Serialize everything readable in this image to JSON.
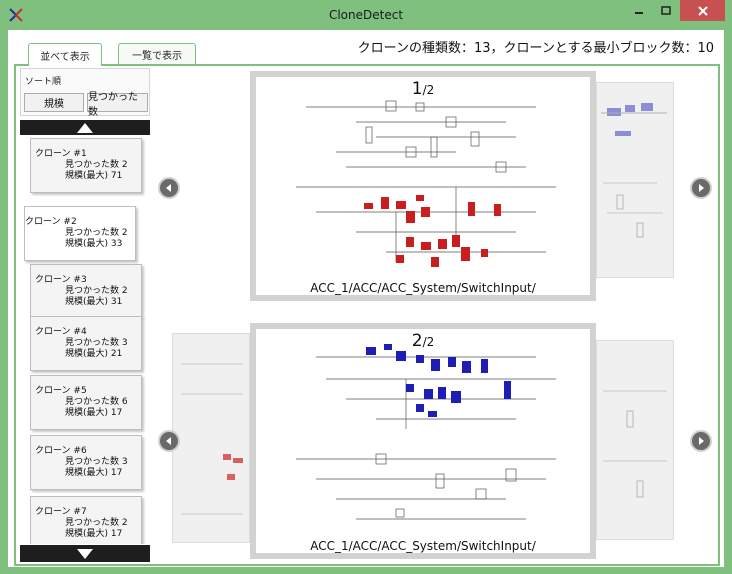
{
  "window": {
    "title": "CloneDetect"
  },
  "header": {
    "info": "クローンの種類数：13，クローンとする最小ブロック数：10"
  },
  "tabs": [
    {
      "label": "並べて表示"
    },
    {
      "label": "一覧で表示"
    }
  ],
  "sort": {
    "label": "ソート順",
    "by_size": "規模",
    "by_found": "見つかった数"
  },
  "clones": [
    {
      "title": "クローン #1",
      "found": "見つかった数  2",
      "size": "規模(最大)  71"
    },
    {
      "title": "クローン #2",
      "found": "見つかった数  2",
      "size": "規模(最大)  33"
    },
    {
      "title": "クローン #3",
      "found": "見つかった数  2",
      "size": "規模(最大)  31"
    },
    {
      "title": "クローン #4",
      "found": "見つかった数  3",
      "size": "規模(最大)  21"
    },
    {
      "title": "クローン #5",
      "found": "見つかった数  6",
      "size": "規模(最大)  17"
    },
    {
      "title": "クローン #6",
      "found": "見つかった数  3",
      "size": "規模(最大)  17"
    },
    {
      "title": "クローン #7",
      "found": "見つかった数  2",
      "size": "規模(最大)  17"
    }
  ],
  "selected_clone": 2,
  "cards": [
    {
      "page": "1",
      "total": "/2",
      "path": "ACC_1/ACC/ACC_System/SwitchInput/",
      "highlight_color": "#c81e1e"
    },
    {
      "page": "2",
      "total": "/2",
      "path": "ACC_1/ACC/ACC_System/SwitchInput/",
      "highlight_color": "#1e1eb4"
    }
  ],
  "colors": {
    "accent": "#7fc07f",
    "close": "#c75050",
    "side_highlight_top": "#8c8cd8",
    "side_highlight_bottom": "#d86060"
  },
  "icons": {
    "app": "clone-detect-icon",
    "prev": "arrow-left-icon",
    "next": "arrow-right-icon",
    "up": "triangle-up-icon",
    "down": "triangle-down-icon"
  }
}
